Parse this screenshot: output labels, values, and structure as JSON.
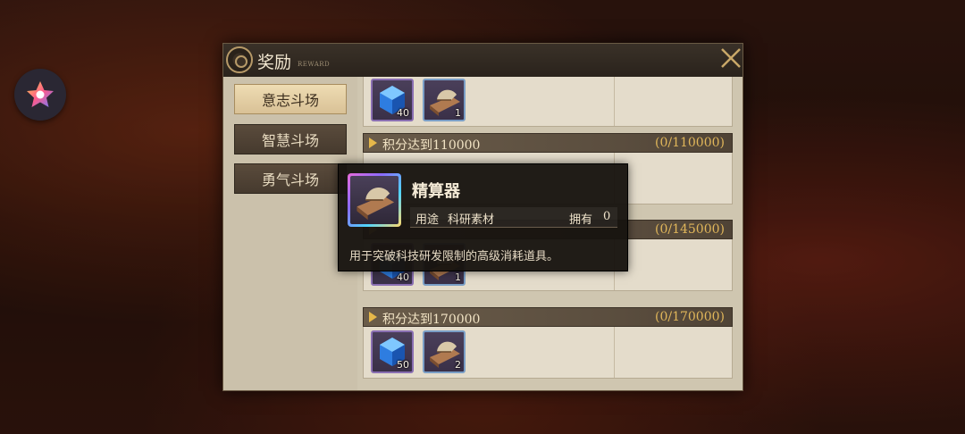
{
  "panel": {
    "title": "奖励",
    "subtitle": "REWARD"
  },
  "tabs": [
    {
      "label": "意志斗场",
      "active": true
    },
    {
      "label": "智慧斗场",
      "active": false
    },
    {
      "label": "勇气斗场",
      "active": false
    }
  ],
  "sections": [
    {
      "condition": "",
      "progress": "",
      "items": [
        {
          "icon": "blue-cube-icon",
          "qty": "40"
        },
        {
          "icon": "abacus-icon",
          "qty": "1"
        }
      ]
    },
    {
      "condition": "积分达到110000",
      "progress": "(0/110000)",
      "items": []
    },
    {
      "condition": "",
      "progress": "(0/145000)",
      "items": [
        {
          "icon": "blue-cube-icon",
          "qty": "40"
        },
        {
          "icon": "abacus-icon",
          "qty": "1"
        }
      ]
    },
    {
      "condition": "积分达到170000",
      "progress": "(0/170000)",
      "items": [
        {
          "icon": "blue-cube-icon",
          "qty": "50"
        },
        {
          "icon": "abacus-icon",
          "qty": "2"
        }
      ]
    }
  ],
  "tooltip": {
    "name": "精算器",
    "usage_label": "用途",
    "usage_value": "科研素材",
    "owned_label": "拥有",
    "owned_value": "0",
    "description": "用于突破科技研发限制的高级消耗道具。",
    "icon": "abacus-icon"
  },
  "colors": {
    "accent_gold": "#e0b65a",
    "tab_active": "#eedcb3",
    "rarity_purple": "#8a6fb2",
    "rarity_blue": "#7a9ec6"
  }
}
